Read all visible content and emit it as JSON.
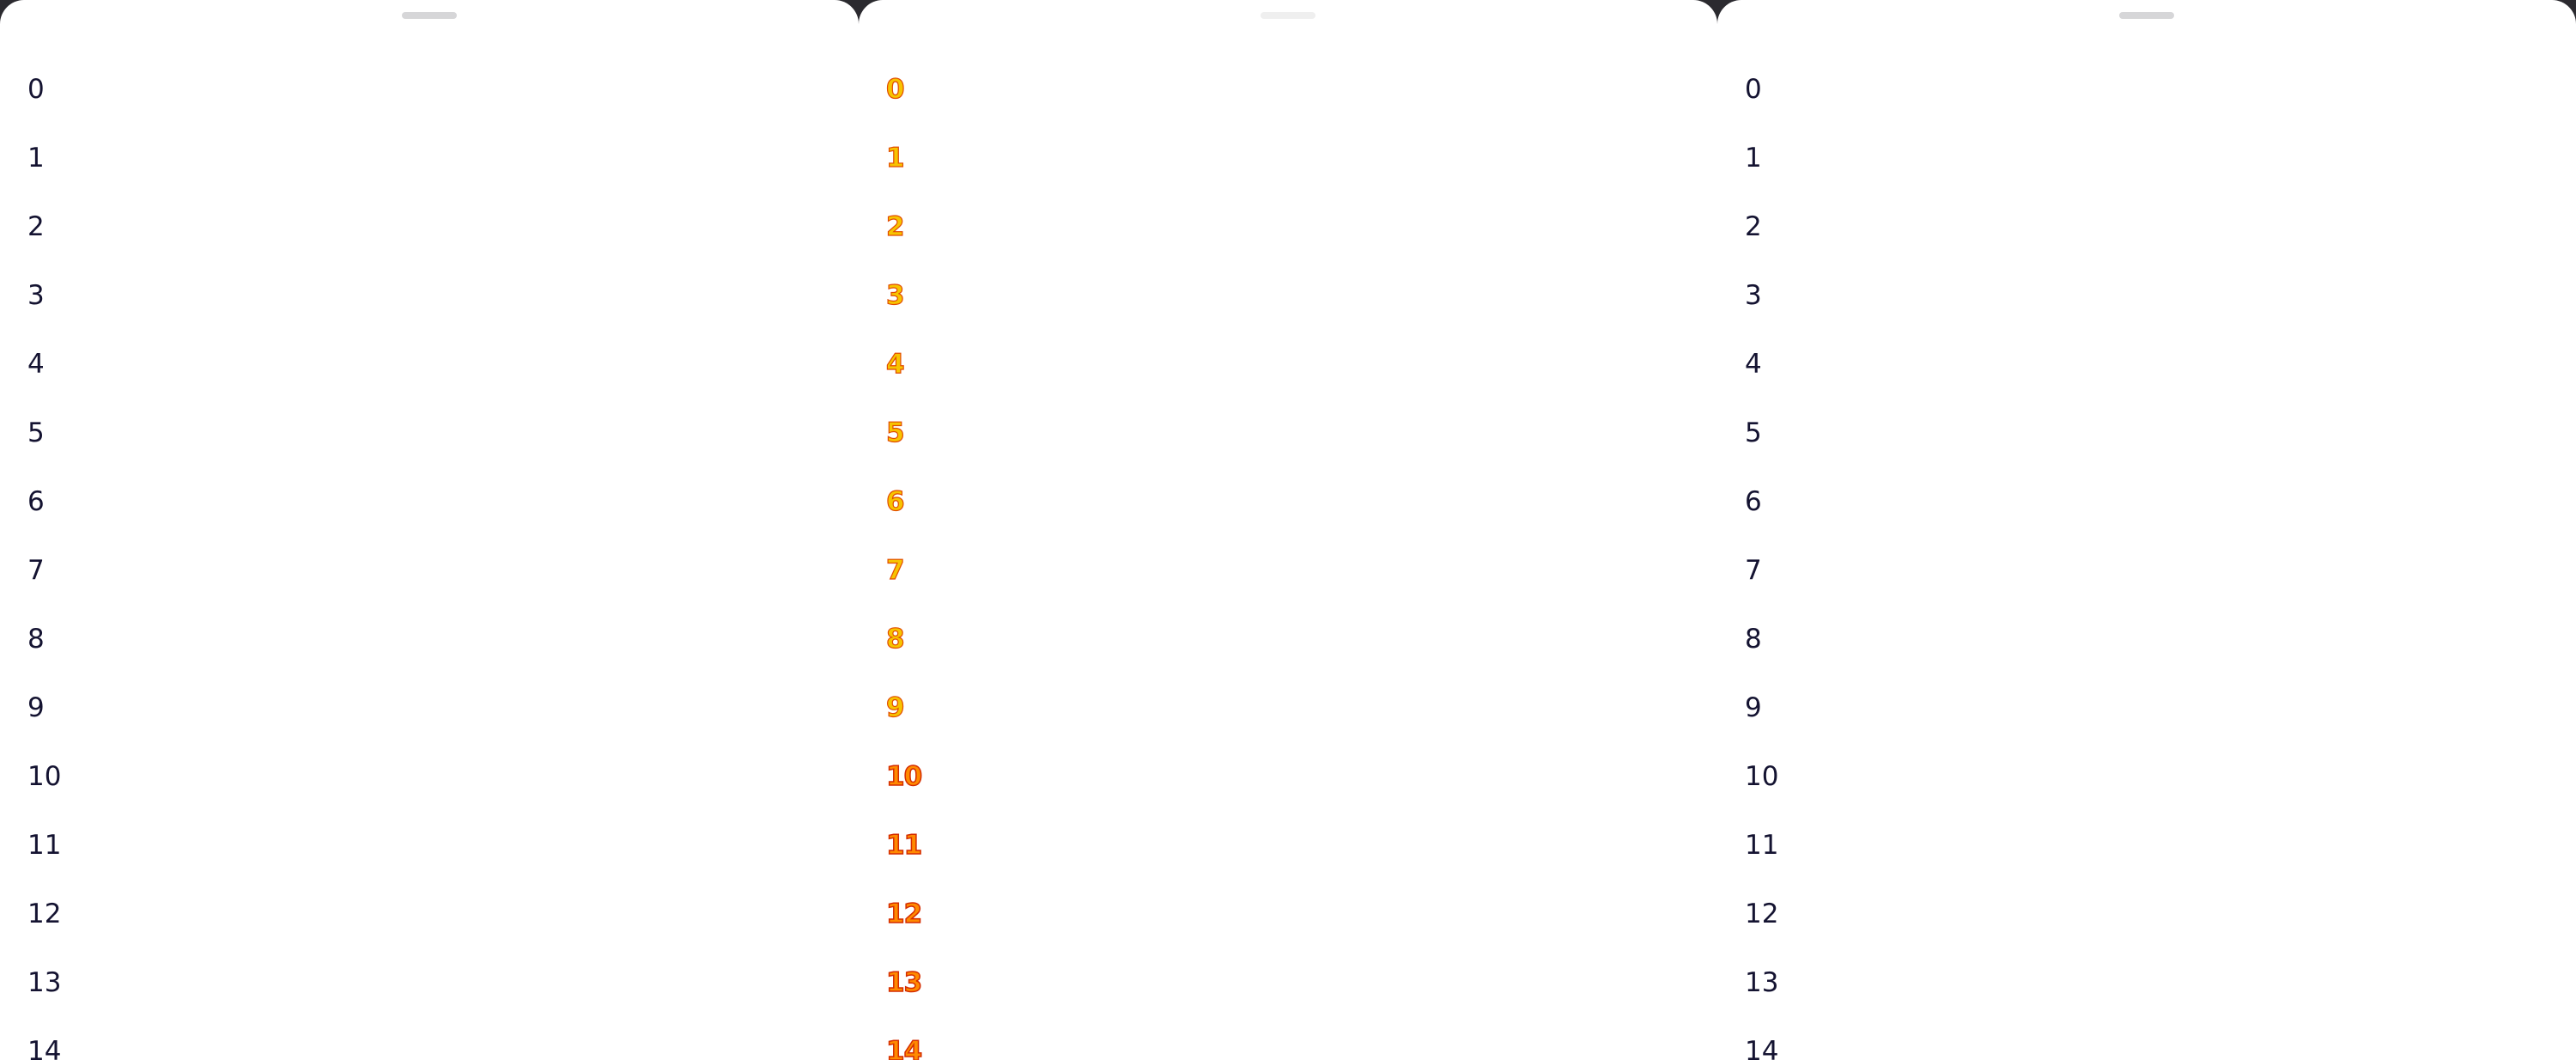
{
  "panels": [
    {
      "items": [
        "0",
        "1",
        "2",
        "3",
        "4",
        "5",
        "6",
        "7",
        "8",
        "9",
        "10",
        "11",
        "12",
        "13",
        "14"
      ]
    },
    {
      "items": [
        "0",
        "1",
        "2",
        "3",
        "4",
        "5",
        "6",
        "7",
        "8",
        "9",
        "10",
        "11",
        "12",
        "13",
        "14"
      ]
    },
    {
      "items": [
        "0",
        "1",
        "2",
        "3",
        "4",
        "5",
        "6",
        "7",
        "8",
        "9",
        "10",
        "11",
        "12",
        "13",
        "14"
      ]
    }
  ],
  "colors": {
    "text": "#141331",
    "handle": "#d6d6d8",
    "highlight_fill": "#f7c400",
    "highlight_stroke": "#e14b00"
  }
}
